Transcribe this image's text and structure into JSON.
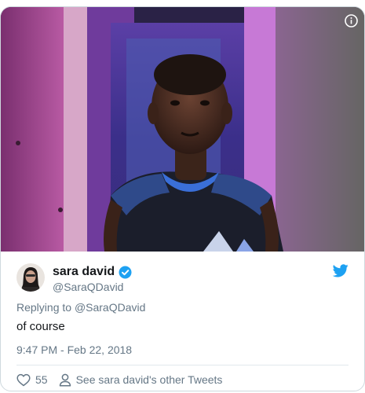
{
  "media": {
    "info_icon": "info-icon"
  },
  "author": {
    "display_name": "sara david",
    "handle": "@SaraQDavid",
    "verified_icon": "verified-badge-icon",
    "avatar": "avatar"
  },
  "brand": {
    "logo_icon": "twitter-bird-icon",
    "accent_color": "#1da1f2"
  },
  "reply": {
    "prefix": "Replying to",
    "mention": "@SaraQDavid"
  },
  "tweet": {
    "text": "of course",
    "timestamp": "9:47 PM - Feb 22, 2018"
  },
  "actions": {
    "like_icon": "heart-icon",
    "like_count": "55",
    "profile_icon": "person-icon",
    "other_tweets_label": "See sara david's other Tweets"
  }
}
